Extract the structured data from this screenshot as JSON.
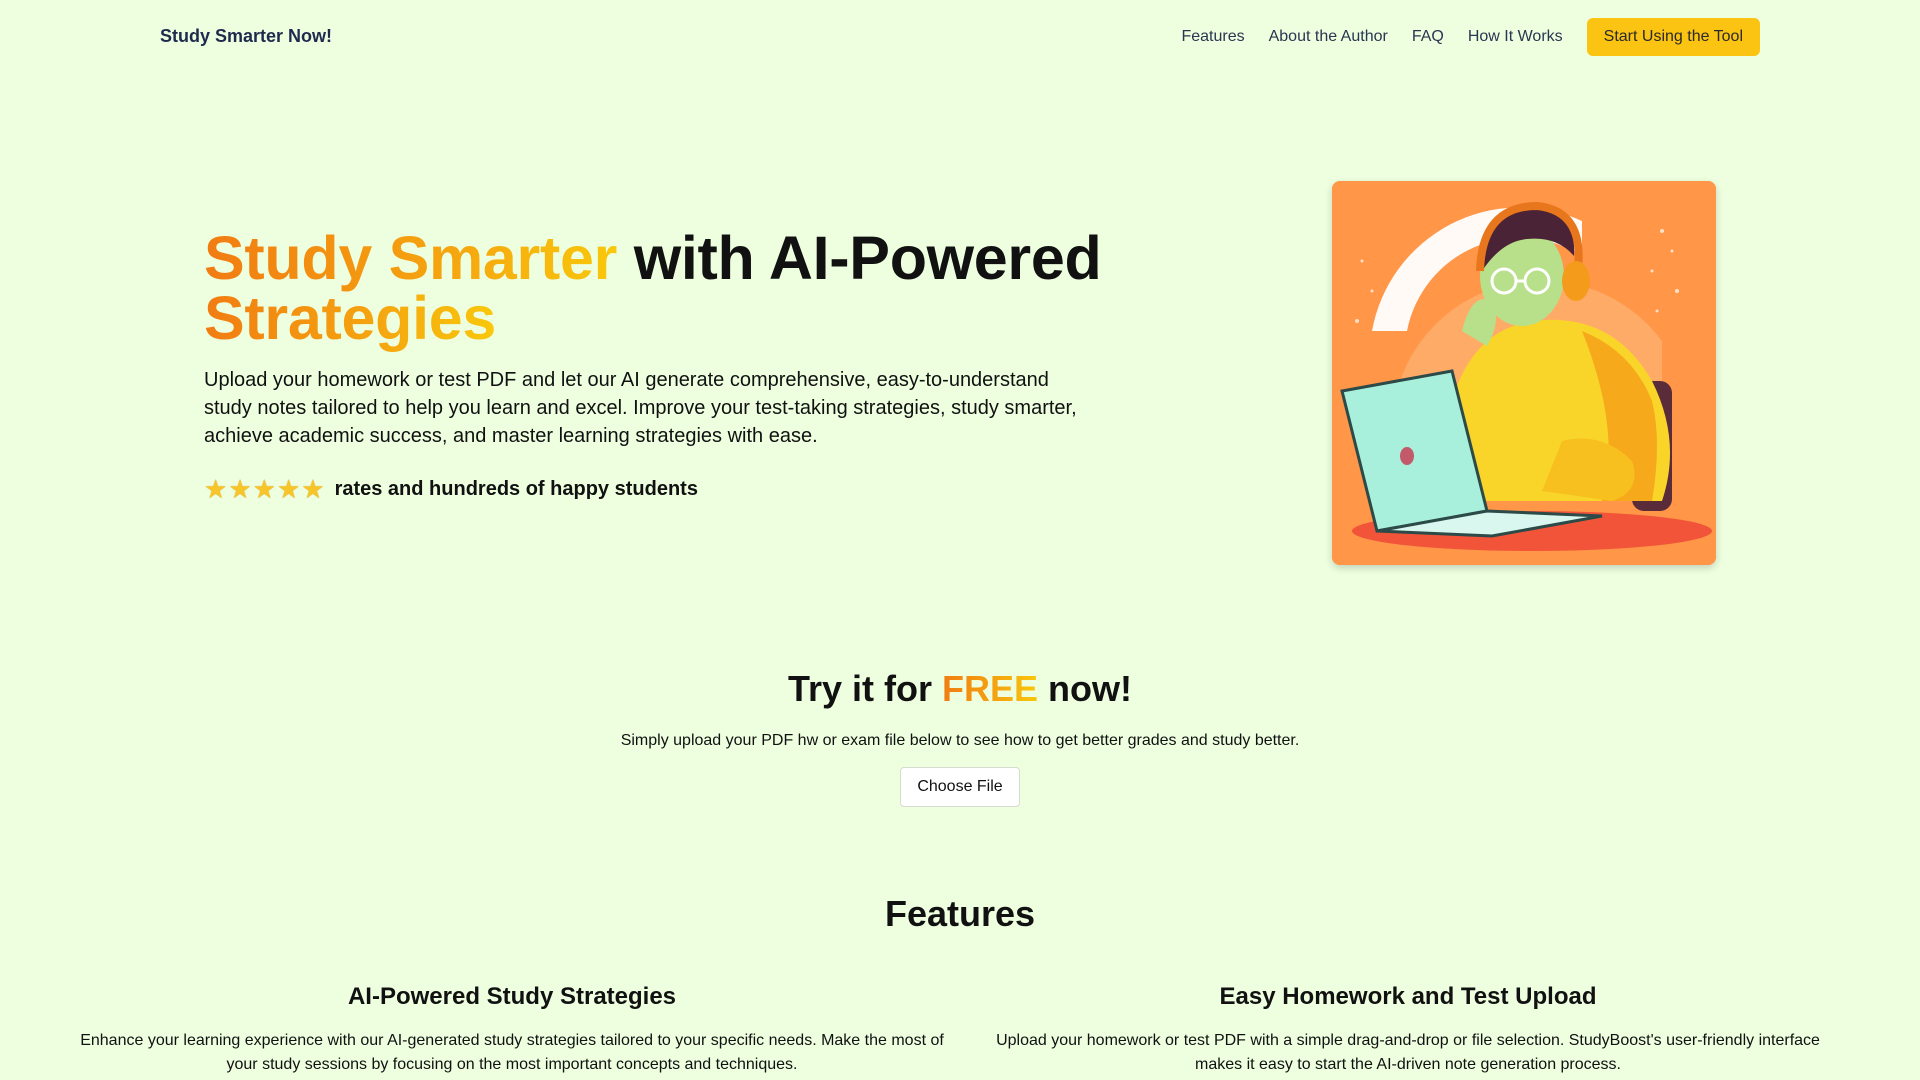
{
  "nav": {
    "brand": "Study Smarter Now!",
    "links": [
      "Features",
      "About the Author",
      "FAQ",
      "How It Works"
    ],
    "cta": "Start Using the Tool"
  },
  "hero": {
    "title_highlight": "Study Smarter",
    "title_rest": "with AI-Powered",
    "title_line2": "Strategies",
    "subtitle": "Upload your homework or test PDF and let our AI generate comprehensive, easy-to-understand study notes tailored to help you learn and excel. Improve your test-taking strategies, study smarter, achieve academic success, and master learning strategies with ease.",
    "rating_stars": 5,
    "rating_text": "rates and hundreds of happy students"
  },
  "try": {
    "title_before": "Try it for",
    "title_highlight": "FREE",
    "title_after": "now!",
    "subtitle": "Simply upload your PDF hw or exam file below to see how to get better grades and study better.",
    "file_button": "Choose File"
  },
  "features": {
    "title": "Features",
    "items": [
      {
        "title": "AI-Powered Study Strategies",
        "text": "Enhance your learning experience with our AI-generated study strategies tailored to your specific needs. Make the most of your study sessions by focusing on the most important concepts and techniques."
      },
      {
        "title": "Easy Homework and Test Upload",
        "text": "Upload your homework or test PDF with a simple drag-and-drop or file selection. StudyBoost's user-friendly interface makes it easy to start the AI-driven note generation process."
      }
    ]
  },
  "colors": {
    "background": "#eeffe0",
    "accent_orange": "#f17c12",
    "accent_yellow": "#fbc312",
    "brand_text": "#1f2a4d"
  }
}
